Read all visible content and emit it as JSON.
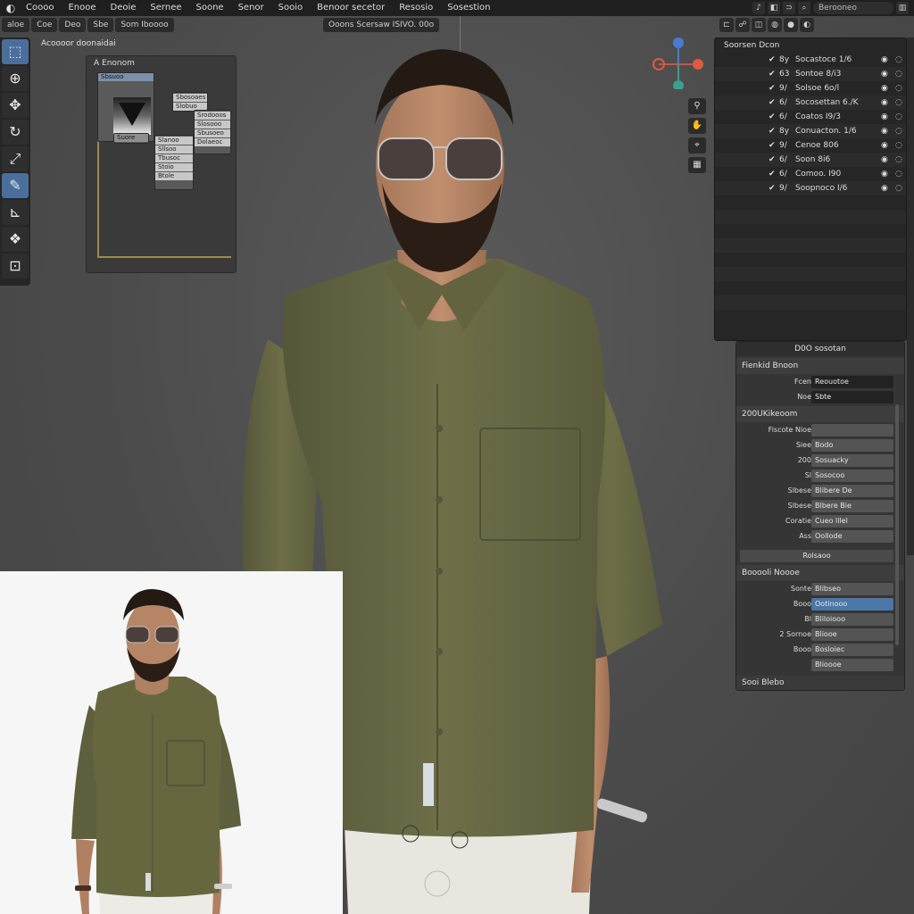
{
  "menubar": {
    "items": [
      "Coooo",
      "Enooe",
      "Deoie",
      "Sernee",
      "Soone",
      "Senor",
      "Sooio",
      "Benoor secetor",
      "Resosio",
      "Sosestion"
    ],
    "search_text": "Berooneo"
  },
  "header2": {
    "mode_chips": [
      "aloe",
      "Coe",
      "Deo",
      "Sbe",
      "Som Iboooo"
    ],
    "center_label": "Ooons Scersaw ISIVO. 00o"
  },
  "viewport": {
    "label": "Acoooor doonaidai"
  },
  "node_panel": {
    "title": "A Enonom",
    "node_top_label": "Sbsuoo",
    "node_mid_label": "Suore",
    "small_nodes": [
      "Sbosoaes",
      "Slobuo",
      "Srodooos",
      "Slosooo",
      "Sbusoeo",
      "Dolaeoc",
      "Slanoo",
      "Sllsoo",
      "Tbusoc",
      "Stoio",
      "Btole"
    ]
  },
  "outliner": {
    "title": "Soorsen Dcon",
    "rows": [
      {
        "icon": "8y",
        "label": "Socastoce 1/6"
      },
      {
        "icon": "63",
        "label": "Sontoe 8/i3"
      },
      {
        "icon": "9/",
        "label": "Solsoe 6o/l"
      },
      {
        "icon": "6/",
        "label": "Socosettan 6./K"
      },
      {
        "icon": "6/",
        "label": "Coatos I9/3"
      },
      {
        "icon": "8y",
        "label": "Conuacton. 1/6"
      },
      {
        "icon": "9/",
        "label": "Cenoe 806"
      },
      {
        "icon": "6/",
        "label": "Soon 8i6"
      },
      {
        "icon": "6/",
        "label": "Comoo. I90"
      },
      {
        "icon": "9/",
        "label": "Soopnoco I/6"
      }
    ]
  },
  "properties": {
    "title": "D0O sosotan",
    "section1": "Fienkid Bnoon",
    "rows1": [
      {
        "label": "Fcen",
        "value": "Reouotoe"
      },
      {
        "label": "Noe",
        "value": "Sbte"
      }
    ],
    "section2": "200UKikeoom",
    "rows2": [
      {
        "label": "Fiscote Nioe",
        "value": ""
      },
      {
        "label": "Siee",
        "value": "Bodo"
      },
      {
        "label": "200",
        "value": "Sosuacky"
      },
      {
        "label": "Sl",
        "value": "Sosocoo"
      },
      {
        "label": "Slbese",
        "value": "Blibere De"
      },
      {
        "label": "Slbese",
        "value": "Blbere Bie"
      },
      {
        "label": "Coratie",
        "value": "Cueo lllel"
      },
      {
        "label": "Ass",
        "value": "Oollode"
      }
    ],
    "wide_button": "Rolsaoo",
    "section3": "Booooli Noooe",
    "rows3": [
      {
        "label": "Sonte",
        "value": "Blibseo"
      },
      {
        "label": "Booo",
        "value": "Ootinooo"
      },
      {
        "label": "Bl",
        "value": "Bliloiooo"
      },
      {
        "label": "2 Sornoe",
        "value": "Bliooe"
      },
      {
        "label": "Booo",
        "value": "Bosloiec"
      },
      {
        "label": "",
        "value": "Blioooe"
      }
    ],
    "footer": "Sooi Blebo"
  },
  "colors": {
    "accent": "#4a76a8",
    "shirt": "#6b6b45",
    "frame": "#a08a4a"
  }
}
